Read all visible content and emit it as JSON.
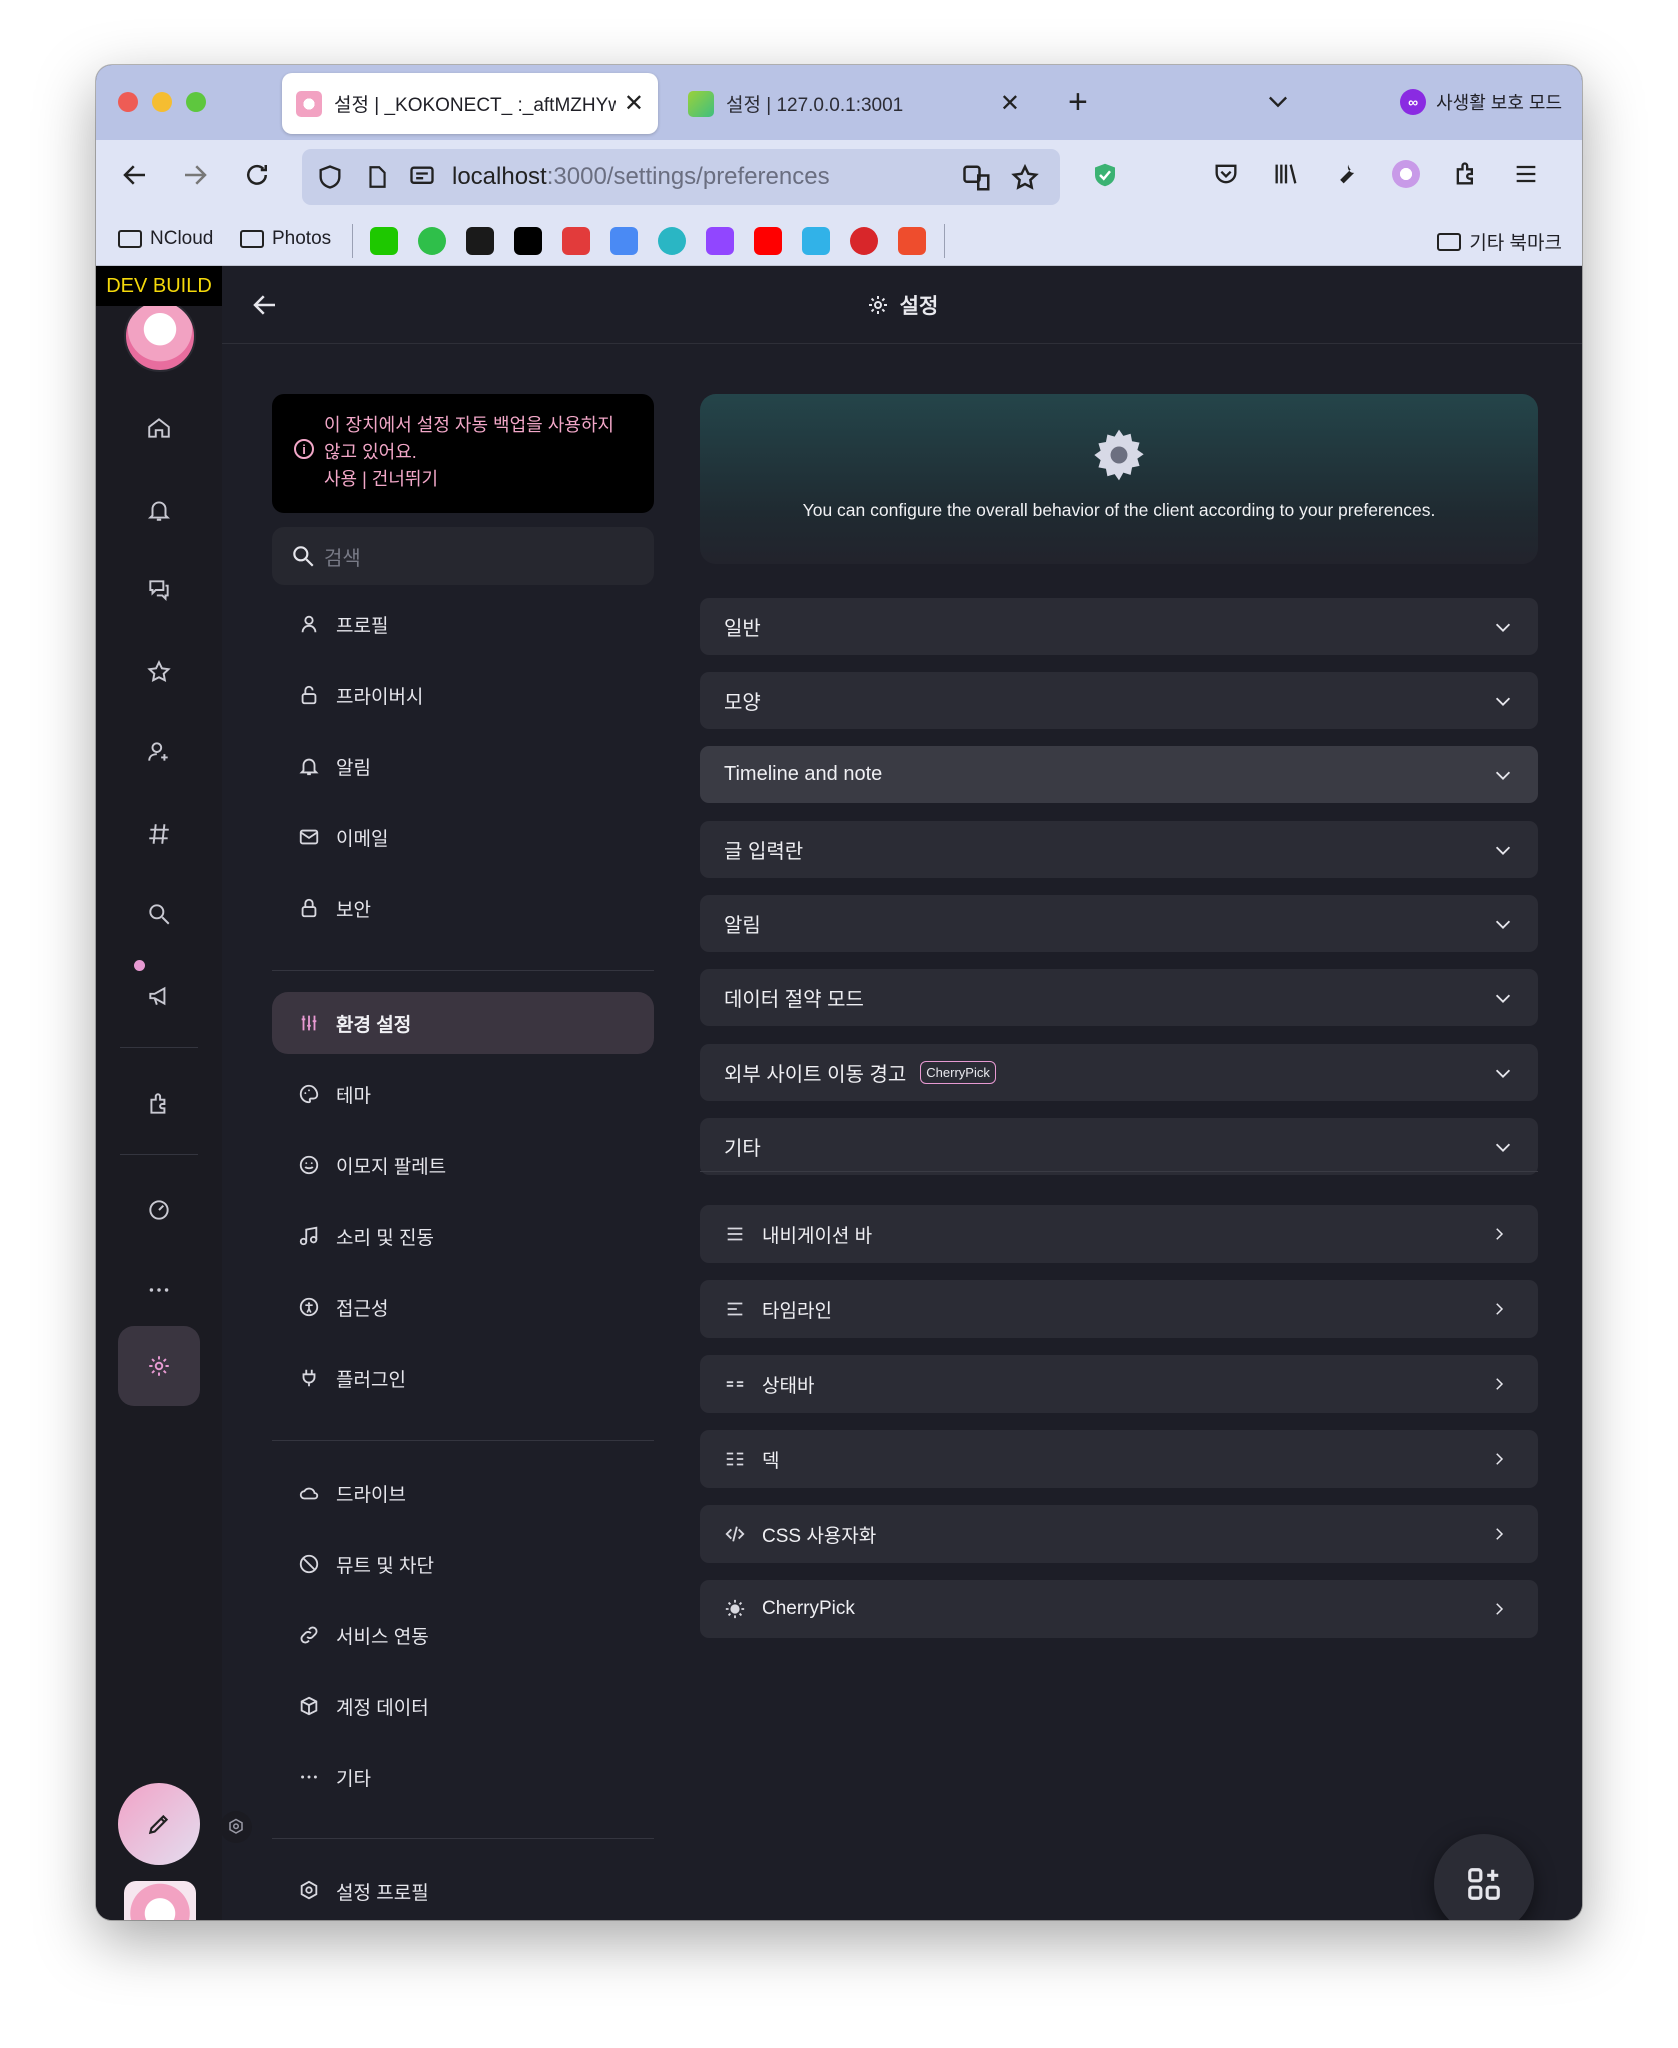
{
  "browser": {
    "tabs": [
      {
        "title": "설정 | _KOKONECT_ :_aftMZHYw",
        "active": true
      },
      {
        "title": "설정 | 127.0.0.1:3001",
        "active": false
      }
    ],
    "private_label": "사생활 보호 모드",
    "url_host": "localhost",
    "url_path": ":3000/settings/preferences",
    "bookmarks": {
      "folder1": "NCloud",
      "folder2": "Photos",
      "other": "기타 북마크"
    }
  },
  "app": {
    "dev_build": "DEV BUILD",
    "header_title": "설정"
  },
  "menu": {
    "notice_line1": "이 장치에서 설정 자동 백업을 사용하지",
    "notice_line2": "않고 있어요.",
    "notice_actions": "사용 | 건너뛰기",
    "search_placeholder": "검색",
    "items": [
      {
        "label": "프로필"
      },
      {
        "label": "프라이버시"
      },
      {
        "label": "알림"
      },
      {
        "label": "이메일"
      },
      {
        "label": "보안"
      },
      {
        "label": "환경 설정"
      },
      {
        "label": "테마"
      },
      {
        "label": "이모지 팔레트"
      },
      {
        "label": "소리 및 진동"
      },
      {
        "label": "접근성"
      },
      {
        "label": "플러그인"
      },
      {
        "label": "드라이브"
      },
      {
        "label": "뮤트 및 차단"
      },
      {
        "label": "서비스 연동"
      },
      {
        "label": "계정 데이터"
      },
      {
        "label": "기타"
      },
      {
        "label": "설정 프로필"
      }
    ]
  },
  "content": {
    "hero_text": "You can configure the overall behavior of the client according to your preferences.",
    "sections": [
      {
        "label": "일반"
      },
      {
        "label": "모양"
      },
      {
        "label": "Timeline and note"
      },
      {
        "label": "글 입력란"
      },
      {
        "label": "알림"
      },
      {
        "label": "데이터 절약 모드"
      },
      {
        "label": "외부 사이트 이동 경고",
        "badge": "CherryPick"
      },
      {
        "label": "기타"
      }
    ],
    "links": [
      {
        "label": "내비게이션 바",
        "icon": "menu-icon"
      },
      {
        "label": "타임라인",
        "icon": "align-left-icon"
      },
      {
        "label": "상태바",
        "icon": "statusbar-icon"
      },
      {
        "label": "덱",
        "icon": "deck-icon"
      },
      {
        "label": "CSS 사용자화",
        "icon": "code-icon"
      },
      {
        "label": "CherryPick",
        "icon": "bulb-icon"
      }
    ]
  },
  "colors": {
    "accent": "#e79ad2",
    "background": "#1d1e27",
    "panel": "#2b2c35",
    "tabbar": "#b9c3e5"
  }
}
